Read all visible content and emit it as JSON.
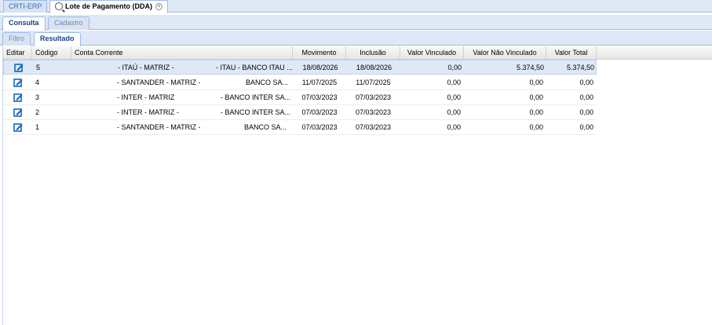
{
  "top_tabs": [
    {
      "label": "CRTI-ERP"
    },
    {
      "label": "Lote de Pagamento (DDA)"
    }
  ],
  "subtabs": [
    {
      "label": "Consulta"
    },
    {
      "label": "Cadastro"
    }
  ],
  "inner_tabs": [
    {
      "label": "Filtro"
    },
    {
      "label": "Resultado"
    }
  ],
  "columns": {
    "editar": "Editar",
    "codigo": "Código",
    "conta": "Conta Corrente",
    "movimento": "Movimento",
    "inclusao": "Inclusão",
    "vinculado": "Valor Vinculado",
    "nao_vinculado": "Valor Não Vinculado",
    "total": "Valor Total"
  },
  "rows": [
    {
      "codigo": "5",
      "conta_a": "- ITAÚ - MATRIZ -",
      "conta_b": "- ITAU - BANCO ITAU ...",
      "movimento": "18/08/2026",
      "inclusao": "18/08/2026",
      "vinculado": "0,00",
      "nao_vinculado": "5.374,50",
      "total": "5.374,50"
    },
    {
      "codigo": "4",
      "conta_a": "- SANTANDER - MATRIZ -",
      "conta_b": "BANCO SA...",
      "movimento": "11/07/2025",
      "inclusao": "11/07/2025",
      "vinculado": "0,00",
      "nao_vinculado": "0,00",
      "total": "0,00"
    },
    {
      "codigo": "3",
      "conta_a": "- INTER - MATRIZ",
      "conta_b": "- BANCO INTER SA...",
      "movimento": "07/03/2023",
      "inclusao": "07/03/2023",
      "vinculado": "0,00",
      "nao_vinculado": "0,00",
      "total": "0,00"
    },
    {
      "codigo": "2",
      "conta_a": "- INTER - MATRIZ -",
      "conta_b": "- BANCO INTER SA...",
      "movimento": "07/03/2023",
      "inclusao": "07/03/2023",
      "vinculado": "0,00",
      "nao_vinculado": "0,00",
      "total": "0,00"
    },
    {
      "codigo": "1",
      "conta_a": "- SANTANDER - MATRIZ -",
      "conta_b": "BANCO SA...",
      "movimento": "07/03/2023",
      "inclusao": "07/03/2023",
      "vinculado": "0,00",
      "nao_vinculado": "0,00",
      "total": "0,00"
    }
  ],
  "icons": {
    "edit": "edit-icon",
    "search": "magnifier-icon",
    "close": "close-icon"
  },
  "colors": {
    "selected_row": "#dfe8f6",
    "tab_border": "#99bbe8",
    "edit_icon": "#1565c0"
  }
}
